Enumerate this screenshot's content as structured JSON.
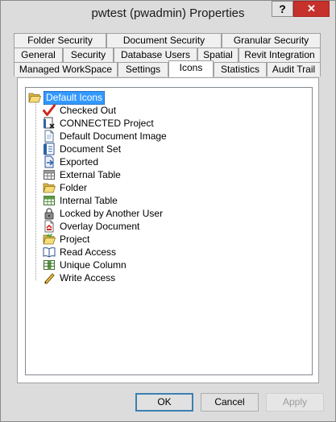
{
  "window": {
    "title": "pwtest (pwadmin) Properties"
  },
  "titlebar": {
    "help_glyph": "?",
    "close_glyph": "✕"
  },
  "tabs": {
    "row1": [
      "Folder Security",
      "Document Security",
      "Granular Security"
    ],
    "row2": [
      "General",
      "Security",
      "Database Users",
      "Spatial",
      "Revit Integration"
    ],
    "row3": [
      "Managed WorkSpace",
      "Settings",
      "Icons",
      "Statistics",
      "Audit Trail"
    ],
    "active": "Icons"
  },
  "tree": {
    "root": {
      "label": "Default Icons",
      "icon": "folder-open-icon"
    },
    "items": [
      {
        "label": "Checked Out",
        "icon": "red-checkmark-icon"
      },
      {
        "label": "CONNECTED Project",
        "icon": "connected-project-icon"
      },
      {
        "label": "Default Document Image",
        "icon": "document-icon"
      },
      {
        "label": "Document Set",
        "icon": "document-set-icon"
      },
      {
        "label": "Exported",
        "icon": "exported-icon"
      },
      {
        "label": "External Table",
        "icon": "external-table-icon"
      },
      {
        "label": "Folder",
        "icon": "folder-icon"
      },
      {
        "label": "Internal Table",
        "icon": "internal-table-icon"
      },
      {
        "label": "Locked by Another User",
        "icon": "lock-icon"
      },
      {
        "label": "Overlay Document",
        "icon": "overlay-document-icon"
      },
      {
        "label": "Project",
        "icon": "project-icon"
      },
      {
        "label": "Read Access",
        "icon": "open-book-icon"
      },
      {
        "label": "Unique Column",
        "icon": "unique-column-icon"
      },
      {
        "label": "Write Access",
        "icon": "pencil-icon"
      }
    ]
  },
  "buttons": {
    "ok": "OK",
    "cancel": "Cancel",
    "apply": "Apply"
  },
  "colors": {
    "selection": "#3399ff",
    "close_button": "#c7312b",
    "checkmark": "#d0261e",
    "folder": "#f0d46a"
  }
}
